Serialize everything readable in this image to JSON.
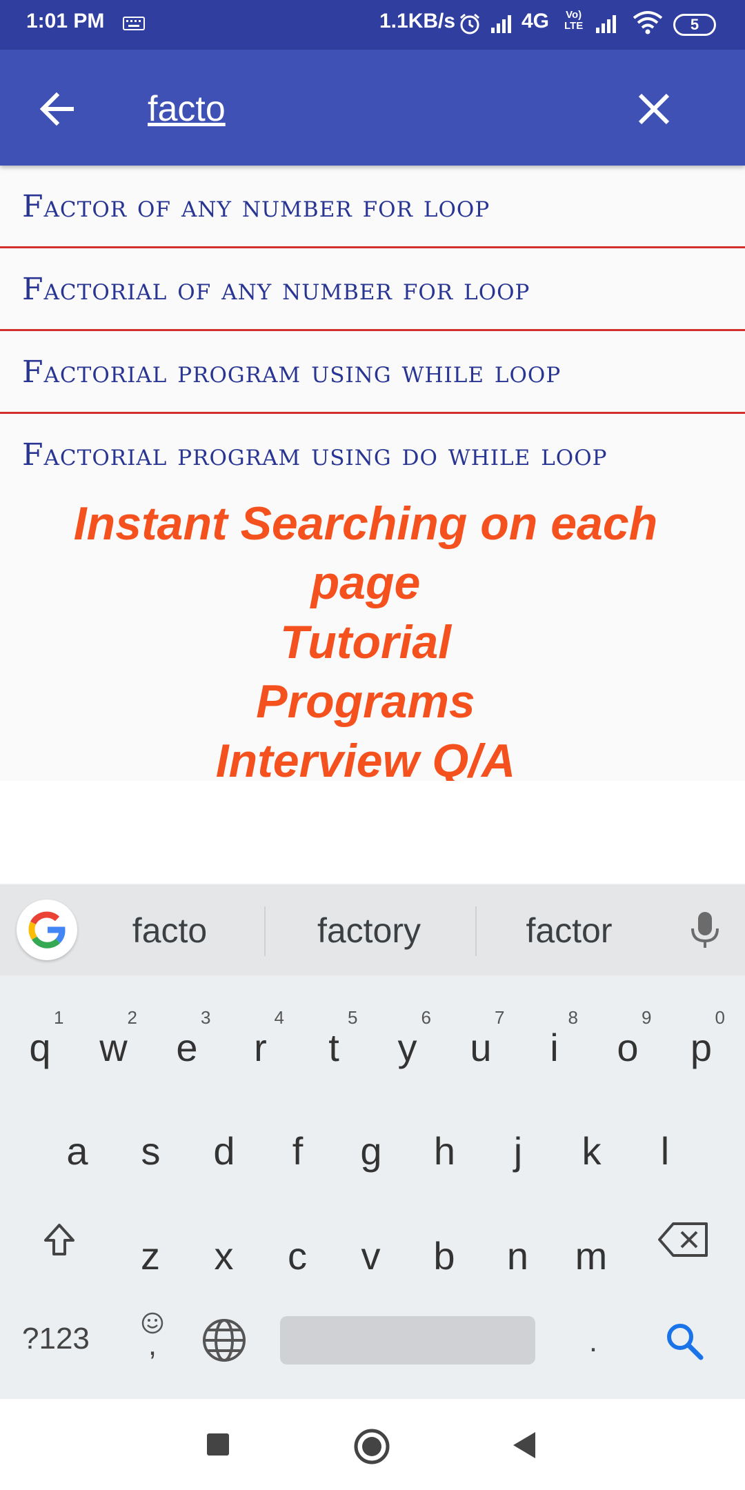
{
  "status_bar": {
    "time": "1:01 PM",
    "speed": "1.1KB/s",
    "network": "4G",
    "volte_line1": "Vo)",
    "volte_line2": "LTE",
    "battery": "5"
  },
  "search": {
    "query": "facto"
  },
  "results": [
    "Factor of any number for loop",
    "Factorial of any number for loop",
    "Factorial program using while loop",
    "Factorial program using do while loop"
  ],
  "promo": {
    "line1": "Instant Searching on each",
    "line2": "page",
    "line3": "Tutorial",
    "line4": "Programs",
    "line5": "Interview Q/A"
  },
  "keyboard": {
    "suggestions": [
      "facto",
      "factory",
      "factor"
    ],
    "row1": [
      "q",
      "w",
      "e",
      "r",
      "t",
      "y",
      "u",
      "i",
      "o",
      "p"
    ],
    "row1_hints": [
      "1",
      "2",
      "3",
      "4",
      "5",
      "6",
      "7",
      "8",
      "9",
      "0"
    ],
    "row2": [
      "a",
      "s",
      "d",
      "f",
      "g",
      "h",
      "j",
      "k",
      "l"
    ],
    "row3": [
      "z",
      "x",
      "c",
      "v",
      "b",
      "n",
      "m"
    ],
    "symbols_key": "?123",
    "comma_key": ",",
    "period_key": "."
  },
  "colors": {
    "status_bar": "#303f9f",
    "app_bar": "#3f51b5",
    "result_text": "#283593",
    "divider": "#d32f2f",
    "promo_text": "#f4511e",
    "search_key": "#1a73e8"
  }
}
